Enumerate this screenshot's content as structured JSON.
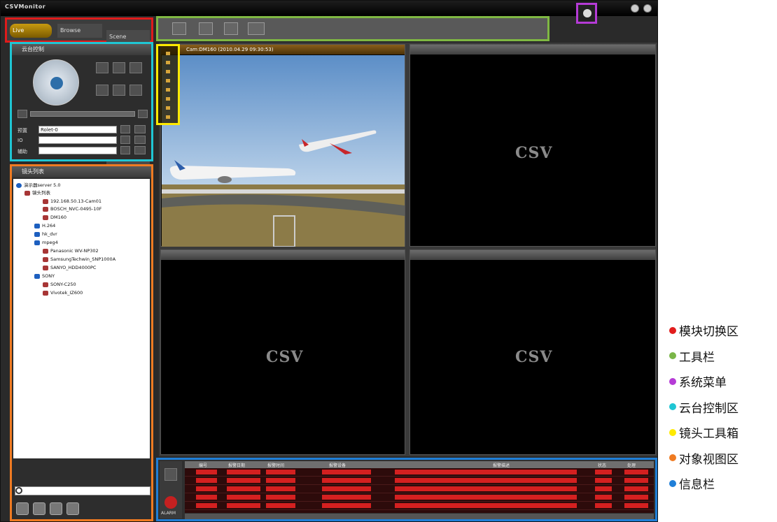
{
  "app": {
    "title": "CSVMonitor"
  },
  "modules": {
    "live": "Live",
    "browse": "Browse",
    "scene": "Scene"
  },
  "ptz": {
    "title": "云台控制",
    "preset_label": "预置",
    "preset_value": "Rolet-0",
    "io_label": "IO",
    "aux_label": "辅助"
  },
  "object_view": {
    "title": "镜头列表",
    "tree": [
      "演示器server 5.0",
      "镜头列表",
      "192.168.50.13-Cam01",
      "BOSCH_NVC-0495-10F",
      "DM160",
      "H.264",
      "hk_dvr",
      "mpeg4",
      "Panasonic WV-NP302",
      "SamsungTechwin_SNP1000A",
      "SANYO_HDD4000PC",
      "SONY",
      "SONY-C250",
      "Vivotek_IZ600"
    ]
  },
  "video": {
    "active_title": "Cam:DM160 (2010.04.29 09:30:53)",
    "logo": "CSV"
  },
  "infobar": {
    "columns": [
      "编号",
      "报警日期",
      "报警时间",
      "报警设备",
      "报警描述",
      "状态",
      "处理"
    ],
    "alarm_label": "ALARM"
  },
  "legend": [
    {
      "label": "模块切换区",
      "color": "#e21d1d"
    },
    {
      "label": "工具栏",
      "color": "#7ab648"
    },
    {
      "label": "系统菜单",
      "color": "#b53bd6"
    },
    {
      "label": "云台控制区",
      "color": "#1fc6d4"
    },
    {
      "label": "镜头工具箱",
      "color": "#ffea00"
    },
    {
      "label": "对象视图区",
      "color": "#ef7b22"
    },
    {
      "label": "信息栏",
      "color": "#1f7fd8"
    }
  ]
}
